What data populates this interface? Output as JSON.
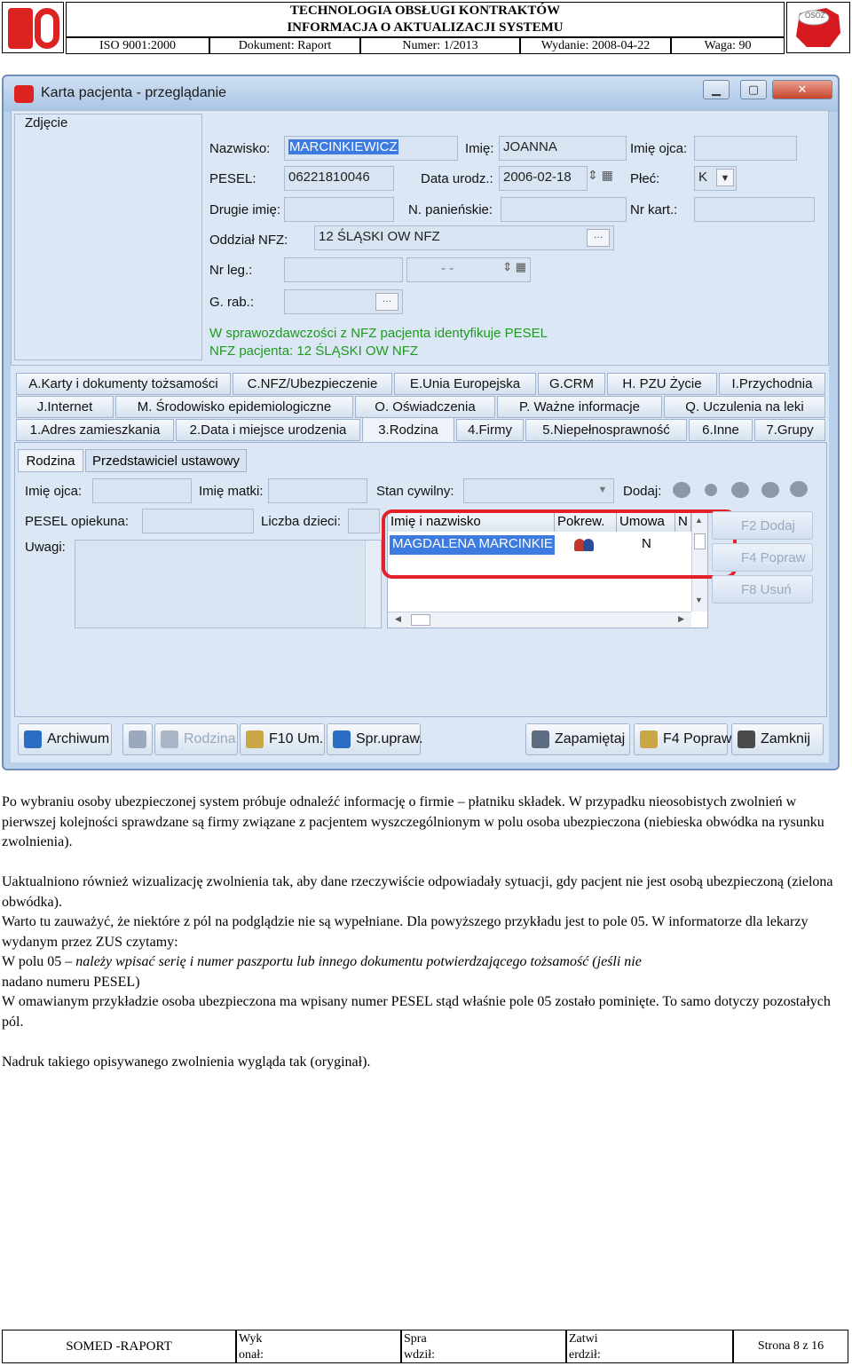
{
  "header": {
    "title_line1": "TECHNOLOGIA OBSŁUGI KONTRAKTÓW",
    "title_line2": "INFORMACJA O AKTUALIZACJI SYSTEMU",
    "iso": "ISO 9001:2000",
    "document": "Dokument: Raport",
    "number": "Numer: 1/2013",
    "edition": "Wydanie: 2008-04-22",
    "weight": "Waga: 90",
    "right_logo_text": "OSOZ"
  },
  "window": {
    "title": "Karta pacjenta - przeglądanie",
    "photo_label": "Zdjęcie",
    "fields": {
      "nazwisko_label": "Nazwisko:",
      "nazwisko_value": "MARCINKIEWICZ",
      "imie_label": "Imię:",
      "imie_value": "JOANNA",
      "imie_ojca_label": "Imię ojca:",
      "imie_ojca_value": "",
      "pesel_label": "PESEL:",
      "pesel_value": "06221810046",
      "data_urodz_label": "Data urodz.:",
      "data_urodz_value": "2006-02-18",
      "plec_label": "Płeć:",
      "plec_value": "K",
      "drugie_imie_label": "Drugie imię:",
      "n_panienskie_label": "N. panieńskie:",
      "nr_kart_label": "Nr kart.:",
      "oddzial_label": "Oddział NFZ:",
      "oddzial_value": "12 ŚLĄSKI OW NFZ",
      "nr_leg_label": "Nr leg.:",
      "nr_leg_date": "-   -",
      "g_rab_label": "G. rab.:"
    },
    "info_line1": "W sprawozdawczości z NFZ pacjenta identyfikuje PESEL",
    "info_line2": "NFZ pacjenta: 12 ŚLĄSKI OW NFZ",
    "tabs_row1": [
      "A.Karty i dokumenty tożsamości",
      "C.NFZ/Ubezpieczenie",
      "E.Unia Europejska",
      "G.CRM",
      "H. PZU Życie",
      "I.Przychodnia"
    ],
    "tabs_row2": [
      "J.Internet",
      "M. Środowisko epidemiologiczne",
      "O. Oświadczenia",
      "P. Ważne informacje",
      "Q. Uczulenia na leki"
    ],
    "tabs_row3": [
      "1.Adres zamieszkania",
      "2.Data i miejsce urodzenia",
      "3.Rodzina",
      "4.Firmy",
      "5.Niepełnosprawność",
      "6.Inne",
      "7.Grupy"
    ],
    "subtabs": [
      "Rodzina",
      "Przedstawiciel ustawowy"
    ],
    "family": {
      "imie_ojca_label": "Imię ojca:",
      "imie_matki_label": "Imię matki:",
      "stan_cywilny_label": "Stan cywilny:",
      "dodaj_label": "Dodaj:",
      "pesel_opiekuna_label": "PESEL opiekuna:",
      "liczba_dzieci_label": "Liczba dzieci:",
      "uwagi_label": "Uwagi:"
    },
    "grid": {
      "columns": [
        "Imię i nazwisko",
        "Pokrew.",
        "Umowa",
        "N"
      ],
      "rows": [
        {
          "name": "MAGDALENA MARCINKIE",
          "umowa": "N"
        }
      ]
    },
    "side_buttons": [
      "F2 Dodaj",
      "F4 Popraw",
      "F8 Usuń"
    ],
    "bottom_buttons": [
      "Archiwum",
      "Rodzina",
      "F10 Um.",
      "Spr.upraw.",
      "Zapamiętaj",
      "F4 Popraw",
      "Zamknij"
    ]
  },
  "body": {
    "p1": "Po wybraniu osoby ubezpieczonej system próbuje odnaleźć informację o firmie – płatniku składek. W przypadku nieosobistych zwolnień w pierwszej kolejności sprawdzane są firmy związane z pacjentem wyszczególnionym w polu osoba ubezpieczona (niebieska obwódka na rysunku zwolnienia).",
    "p2": "Uaktualniono również wizualizację zwolnienia tak, aby dane rzeczywiście odpowiadały sytuacji, gdy pacjent nie jest osobą ubezpieczoną (zielona obwódka).",
    "p3": "Warto tu zauważyć, że niektóre z pól na podglądzie nie są wypełniane. Dla powyższego przykładu jest to pole 05. W informatorze dla lekarzy wydanym przez ZUS czytamy:",
    "p4_prefix": "W polu 05 – ",
    "p4_italic": "należy wpisać serię i numer paszportu lub innego dokumentu potwierdzającego tożsamość (jeśli nie",
    "p4_line2": "nadano numeru PESEL)",
    "p5": "W omawianym przykładzie osoba ubezpieczona ma wpisany numer PESEL stąd właśnie pole 05 zostało pominięte. To samo dotyczy pozostałych pól.",
    "p6": "Nadruk takiego opisywanego zwolnienia wygląda tak (oryginał)."
  },
  "footer": {
    "name": "SOMED -RAPORT",
    "wykonal": "Wyk onał:",
    "sprawdzil": "Spra wdził:",
    "zatwierdzil": "Zatwi erdził:",
    "page": "Strona 8 z 16"
  }
}
